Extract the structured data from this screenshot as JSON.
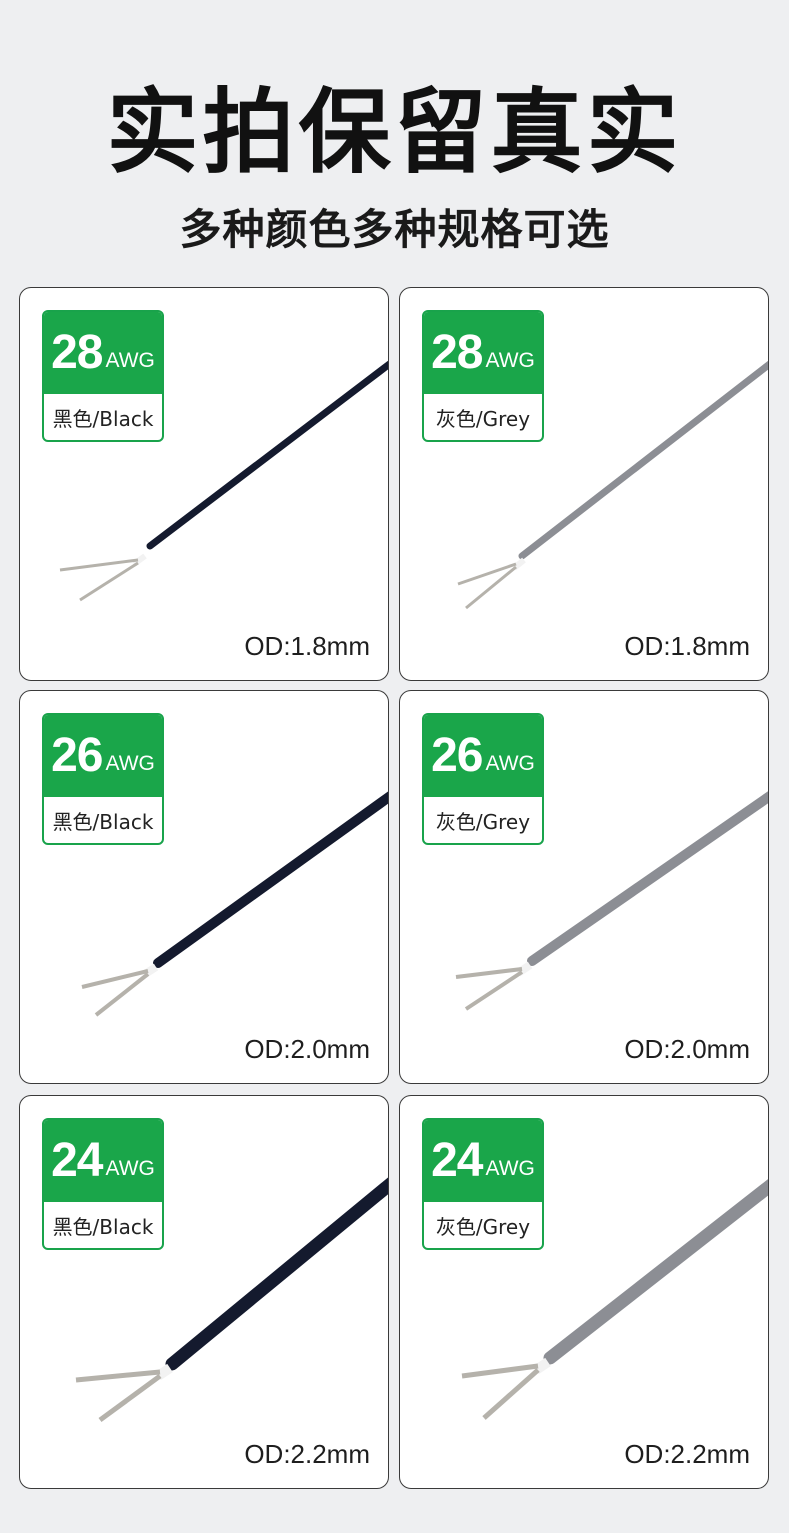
{
  "header": {
    "title": "实拍保留真实",
    "subtitle": "多种颜色多种规格可选"
  },
  "cards": [
    {
      "gauge": "28",
      "unit": "AWG",
      "color_label": "黑色/Black",
      "od": "OD:1.8mm",
      "wire_color": "#141a2e"
    },
    {
      "gauge": "28",
      "unit": "AWG",
      "color_label": "灰色/Grey",
      "od": "OD:1.8mm",
      "wire_color": "#8c8e94"
    },
    {
      "gauge": "26",
      "unit": "AWG",
      "color_label": "黑色/Black",
      "od": "OD:2.0mm",
      "wire_color": "#141a2e"
    },
    {
      "gauge": "26",
      "unit": "AWG",
      "color_label": "灰色/Grey",
      "od": "OD:2.0mm",
      "wire_color": "#8c8e94"
    },
    {
      "gauge": "24",
      "unit": "AWG",
      "color_label": "黑色/Black",
      "od": "OD:2.2mm",
      "wire_color": "#141a2e"
    },
    {
      "gauge": "24",
      "unit": "AWG",
      "color_label": "灰色/Grey",
      "od": "OD:2.2mm",
      "wire_color": "#8c8e94"
    }
  ],
  "colors": {
    "badge_green": "#1aa64a",
    "background": "#eeeff1"
  }
}
